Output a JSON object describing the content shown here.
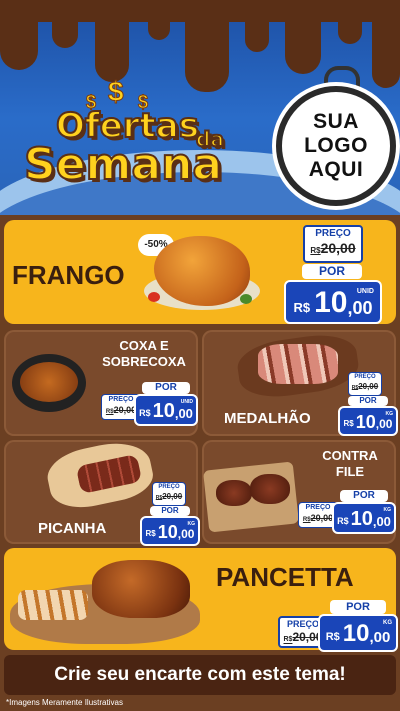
{
  "header": {
    "title_line1": "Ofertas",
    "title_da": "da",
    "title_line2": "Semana",
    "logo_line1": "SUA",
    "logo_line2": "LOGO",
    "logo_line3": "AQUI"
  },
  "labels": {
    "price": "PREÇO",
    "por": "POR",
    "currency": "R$"
  },
  "products": {
    "frango": {
      "name": "FRANGO",
      "discount": "-50%",
      "old_price": "20,00",
      "price_int": "10",
      "price_dec": ",00",
      "unit": "UNID"
    },
    "coxa": {
      "name_line1": "COXA E",
      "name_line2": "SOBRECOXA",
      "old_price": "20,00",
      "price_int": "10",
      "price_dec": ",00",
      "unit": "UNID"
    },
    "medalhao": {
      "name": "MEDALHÃO",
      "old_price": "20,00",
      "price_int": "10",
      "price_dec": ",00",
      "unit": "KG"
    },
    "picanha": {
      "name": "PICANHA",
      "old_price": "20,00",
      "price_int": "10",
      "price_dec": ",00",
      "unit": "KG"
    },
    "contrafile": {
      "name_line1": "CONTRA",
      "name_line2": "FILE",
      "old_price": "20,00",
      "price_int": "10",
      "price_dec": ",00",
      "unit": "KG"
    },
    "pancetta": {
      "name": "PANCETTA",
      "old_price": "20,00",
      "price_int": "10",
      "price_dec": ",00",
      "unit": "KG"
    }
  },
  "footer": {
    "cta": "Crie seu encarte com este tema!",
    "note": "*Imagens Meramente Ilustrativas"
  },
  "colors": {
    "brand_yellow": "#f7b51c",
    "chocolate": "#5a2f16",
    "price_blue": "#1a45b8"
  }
}
